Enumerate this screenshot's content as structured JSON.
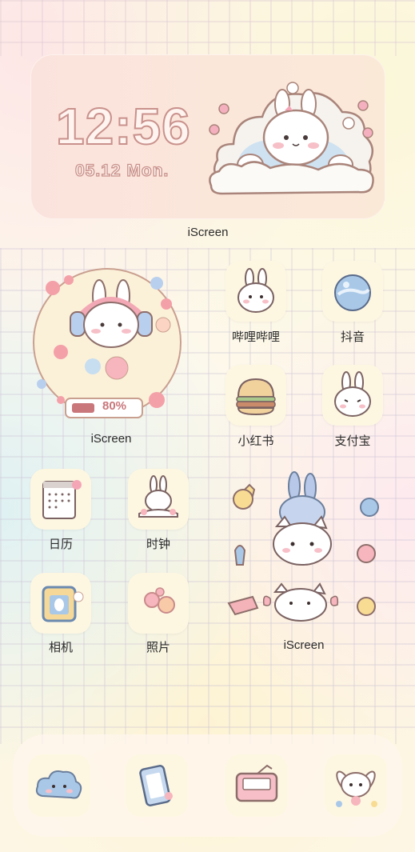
{
  "clock_widget": {
    "time": "12:56",
    "date": "05.12  Mon.",
    "label": "iScreen"
  },
  "music_widget": {
    "battery": "80%",
    "label": "iScreen"
  },
  "pets_widget": {
    "label": "iScreen"
  },
  "apps": [
    {
      "label": "哔哩哔哩",
      "icon": "bunny-face-icon"
    },
    {
      "label": "抖音",
      "icon": "planet-icon"
    },
    {
      "label": "小红书",
      "icon": "burger-icon"
    },
    {
      "label": "支付宝",
      "icon": "bunny-face-icon"
    },
    {
      "label": "日历",
      "icon": "calendar-icon"
    },
    {
      "label": "时钟",
      "icon": "bunny-clock-icon"
    },
    {
      "label": "相机",
      "icon": "camera-icon"
    },
    {
      "label": "照片",
      "icon": "flowers-icon"
    }
  ],
  "dock": [
    {
      "icon": "cloud-icon"
    },
    {
      "icon": "phone-icon"
    },
    {
      "icon": "wallet-icon"
    },
    {
      "icon": "bunny-icon"
    }
  ],
  "colors": {
    "outline": "#c9918c",
    "pink": "#f4b5bf",
    "blue": "#a9c8e8",
    "cream": "#fdf7e2"
  }
}
